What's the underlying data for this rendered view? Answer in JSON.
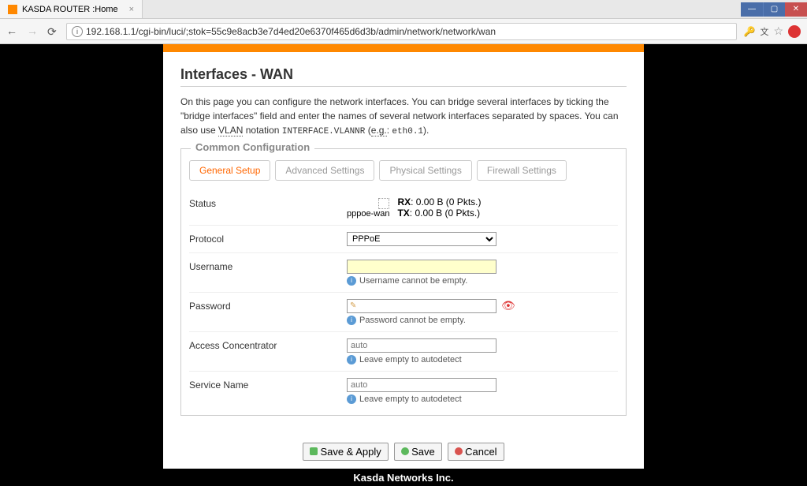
{
  "browser": {
    "tab_title": "KASDA ROUTER :Home",
    "url": "192.168.1.1/cgi-bin/luci/;stok=55c9e8acb3e7d4ed20e6370f465d6d3b/admin/network/network/wan"
  },
  "page": {
    "title": "Interfaces - WAN",
    "description_part1": "On this page you can configure the network interfaces. You can bridge several interfaces by ticking the \"bridge interfaces\" field and enter the names of several network interfaces separated by spaces. You can also use ",
    "description_vlan": "VLAN",
    "description_part2": " notation ",
    "description_code1": "INTERFACE.VLANNR",
    "description_part3": " (",
    "description_eg": "e.g.",
    "description_part4": ": ",
    "description_code2": "eth0.1",
    "description_part5": ")."
  },
  "fieldset": {
    "legend": "Common Configuration"
  },
  "tabs": {
    "general": "General Setup",
    "advanced": "Advanced Settings",
    "physical": "Physical Settings",
    "firewall": "Firewall Settings"
  },
  "fields": {
    "status": {
      "label": "Status",
      "proto_name": "pppoe-wan",
      "rx_label": "RX",
      "rx_value": ": 0.00 B (0 Pkts.)",
      "tx_label": "TX",
      "tx_value": ": 0.00 B (0 Pkts.)"
    },
    "protocol": {
      "label": "Protocol",
      "value": "PPPoE"
    },
    "username": {
      "label": "Username",
      "hint": "Username cannot be empty."
    },
    "password": {
      "label": "Password",
      "hint": "Password cannot be empty."
    },
    "access_concentrator": {
      "label": "Access Concentrator",
      "placeholder": "auto",
      "hint": "Leave empty to autodetect"
    },
    "service_name": {
      "label": "Service Name",
      "placeholder": "auto",
      "hint": "Leave empty to autodetect"
    }
  },
  "buttons": {
    "save_apply": "Save & Apply",
    "save": "Save",
    "cancel": "Cancel"
  },
  "footer": "Kasda Networks Inc."
}
